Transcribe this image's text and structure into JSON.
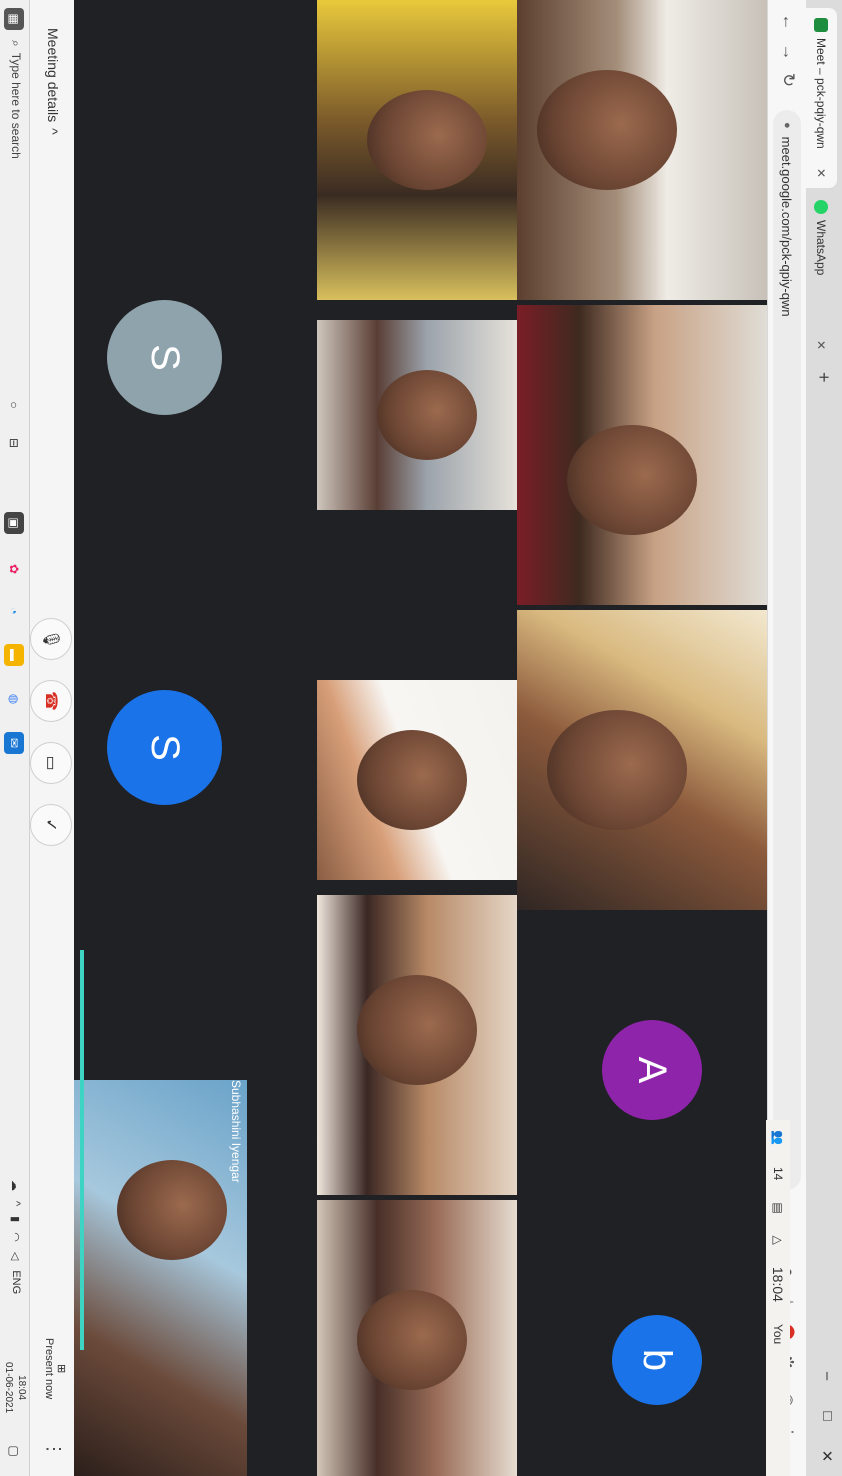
{
  "browser": {
    "tabs": [
      {
        "label": "Meet – pck-pqiy-qwn",
        "favicon_color": "#1e8e3e"
      },
      {
        "label": "WhatsApp",
        "favicon_color": "#25d366"
      }
    ],
    "new_tab": "+",
    "address": "meet.google.com/pck-qpiy-qwn",
    "window_controls": {
      "minimize": "–",
      "maximize": "□",
      "close": "✕"
    }
  },
  "meet": {
    "active_speaker": "Subhashini Iyengar",
    "avatars": [
      {
        "letter": "S",
        "color": "#8fa3ad"
      },
      {
        "letter": "S",
        "color": "#1a73e8"
      },
      {
        "letter": "A",
        "color": "#8e24aa"
      },
      {
        "letter": "b",
        "color": "#1a73e8"
      }
    ],
    "top_right": {
      "people_count": "14",
      "time": "18:04",
      "self_label": "You"
    },
    "bottom_bar": {
      "meeting_details": "Meeting details",
      "present_now": "Present now",
      "more": "⋮"
    }
  },
  "taskbar": {
    "search_placeholder": "Type here to search",
    "language": "ENG",
    "clock_time": "18:04",
    "clock_date": "01-06-2021"
  },
  "colors": {
    "meet_bg": "#202124",
    "end_call": "#d93025",
    "accent": "#1a73e8"
  }
}
